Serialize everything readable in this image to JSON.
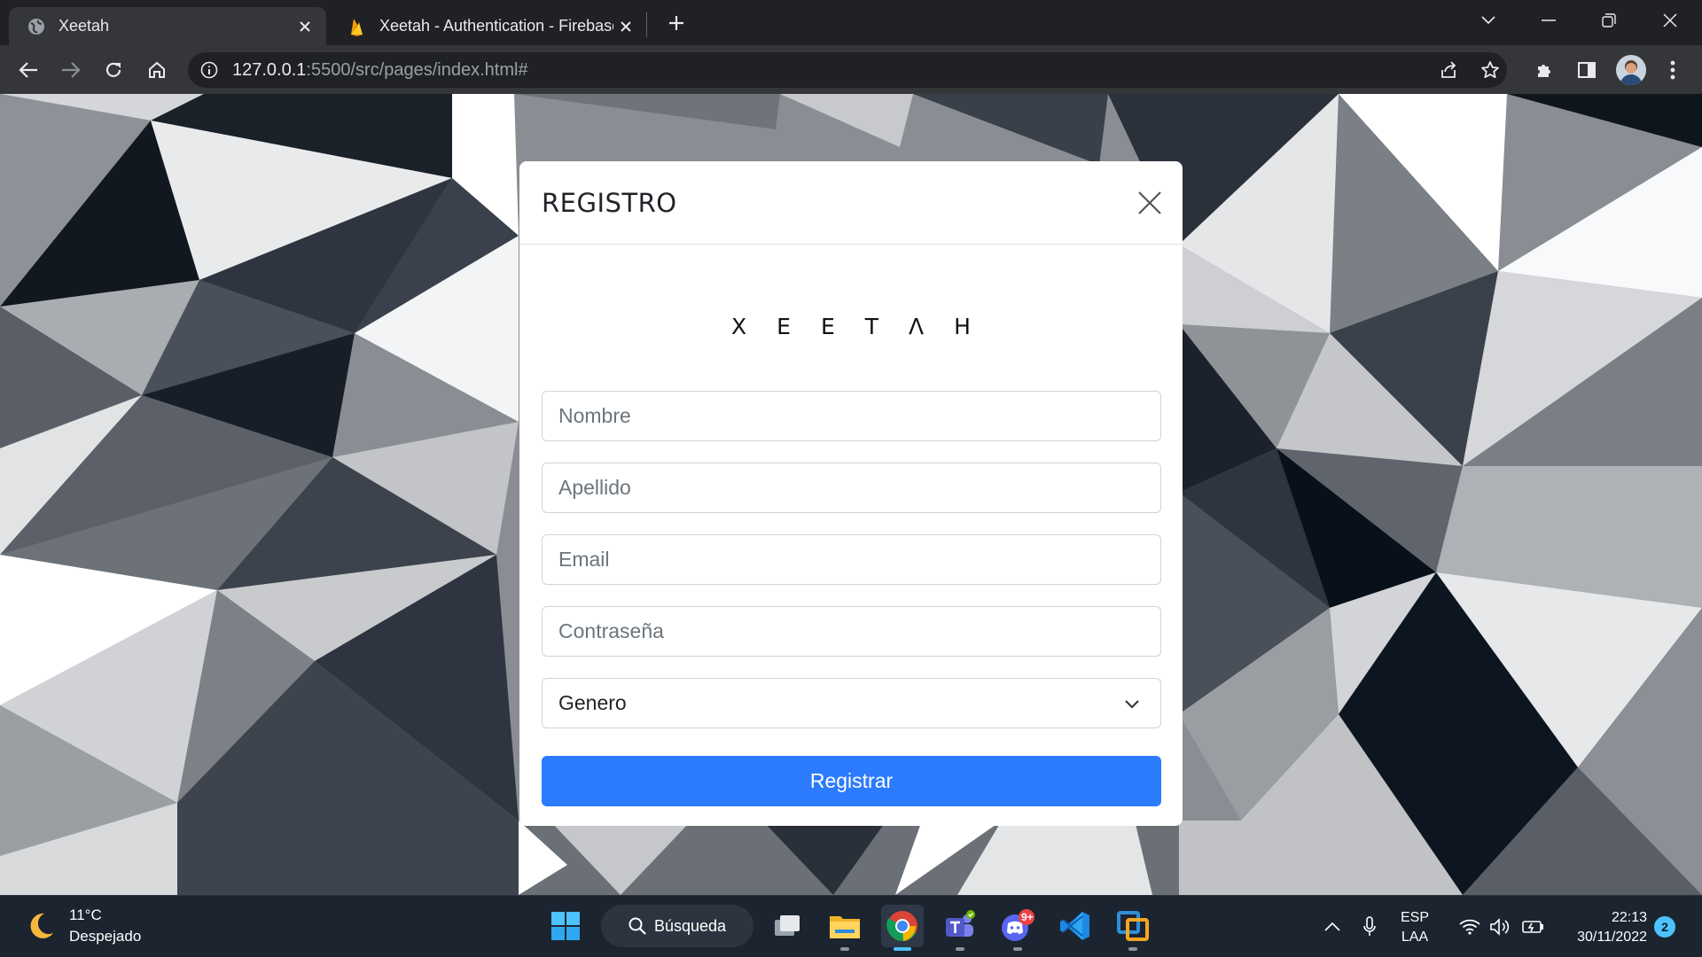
{
  "browser": {
    "tabs": [
      {
        "title": "Xeetah",
        "active": true,
        "icon": "globe-icon"
      },
      {
        "title": "Xeetah - Authentication - Firebase",
        "active": false,
        "icon": "firebase-icon"
      }
    ],
    "address_host": "127.0.0.1",
    "address_rest": ":5500/src/pages/index.html#"
  },
  "modal": {
    "title": "REGISTRO",
    "logo": "XEETΛH",
    "fields": {
      "nombre_placeholder": "Nombre",
      "apellido_placeholder": "Apellido",
      "email_placeholder": "Email",
      "password_placeholder": "Contraseña"
    },
    "genero_selected": "Genero",
    "submit_label": "Registrar"
  },
  "taskbar": {
    "weather_temp": "11°C",
    "weather_desc": "Despejado",
    "search_label": "Búsqueda",
    "lang_line1": "ESP",
    "lang_line2": "LAA",
    "time": "22:13",
    "date": "30/11/2022",
    "notifications": "2",
    "discord_badge": "9+"
  },
  "colors": {
    "accent": "#2d7bfd",
    "chrome_dark": "#202124",
    "chrome_toolbar": "#35363a",
    "taskbar": "#1c2430"
  }
}
